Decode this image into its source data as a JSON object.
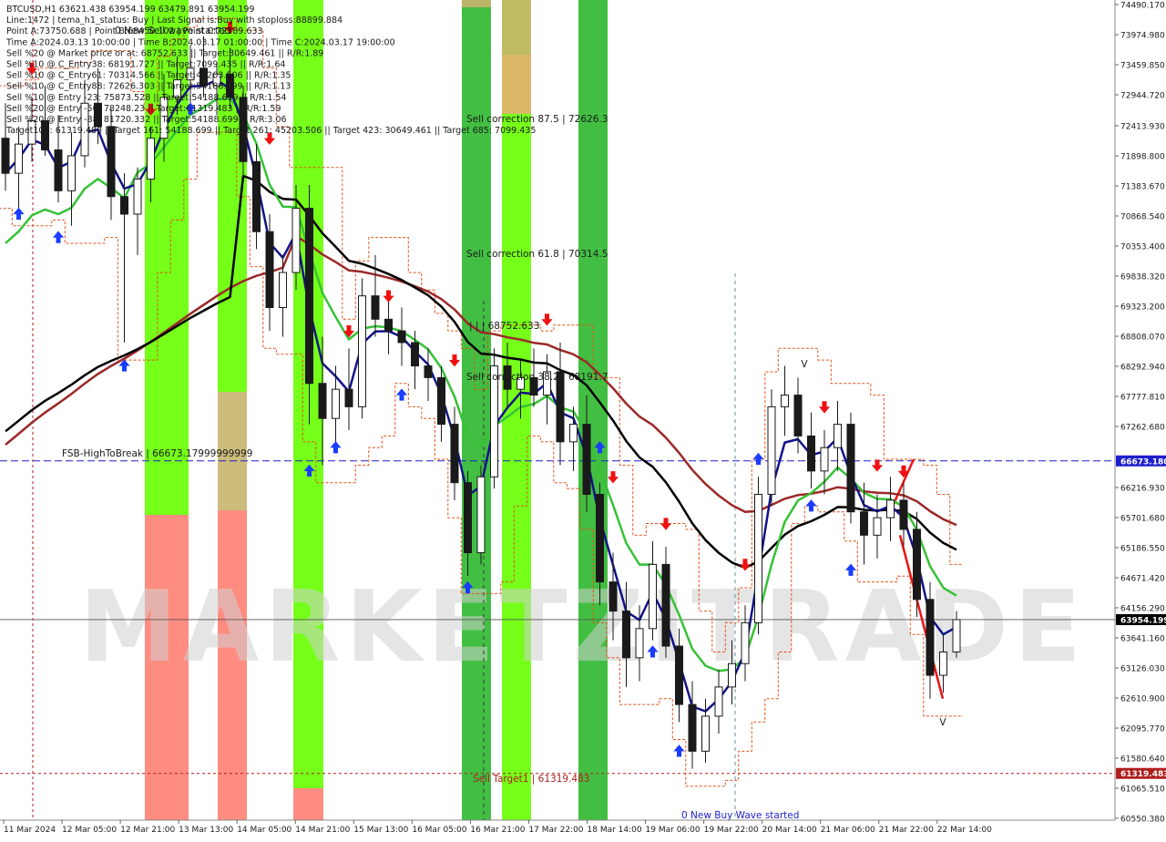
{
  "chart_data": {
    "type": "candlestick",
    "symbol": "BTCUSD",
    "timeframe": "H1",
    "info_lines": [
      "BTCUSD,H1   63621.438 63954.199 63479.891 63954.199",
      "Line:1472 | tema_h1_status: Buy | Last Signal is:Buy with stoploss:88899.884",
      "Point A:73750.688 | Point B:68450.102 | Point C:72389.633",
      "Time A:2024.03.13 10:00:00 | Time B:2024.03.17 01:00:00 | Time C:2024.03.17 19:00:00",
      "Sell %20 @ Market price or at: 68752.633 || Target:30649.461 || R/R:1.89",
      "Sell %10 @ C_Entry38: 68191.727 || Target:7099.435 || R/R:1.64",
      "Sell %10 @ C_Entry61: 70314.566 || Target:45203.506 || R/R:1.35",
      "Sell %10 @ C_Entry88: 72626.303 || Target:54188.699 || R/R:1.13",
      "Sell %10 @ Entry -23: 75873.528 || Target:54188.699 || R/R:1.54",
      "Sell %20 @ Entry -50: 78248.23 || Target:61319.483 || R/R:1.59",
      "Sell %20 @ Entry -88: 81720.332 || Target:54188.699 || R/R:3.06",
      "Target100: 61319.483 || Target 161: 54188.699 || Target 261: 45203.506 || Target 423: 30649.461 || Target 685: 7099.435"
    ],
    "y_ticks": [
      "74490.170",
      "73974.980",
      "73459.850",
      "72944.720",
      "72413.930",
      "71898.800",
      "71383.670",
      "70868.540",
      "70353.400",
      "69838.320",
      "69323.200",
      "68808.070",
      "68292.940",
      "67777.810",
      "67262.680",
      "66216.930",
      "65701.680",
      "65186.550",
      "64671.420",
      "64156.290",
      "63641.160",
      "63126.030",
      "62610.900",
      "62095.770",
      "61580.640",
      "61065.510",
      "60550.380"
    ],
    "x_ticks": [
      "11 Mar 2024",
      "12 Mar 05:00",
      "12 Mar 21:00",
      "13 Mar 13:00",
      "14 Mar 05:00",
      "14 Mar 21:00",
      "15 Mar 13:00",
      "16 Mar 05:00",
      "16 Mar 21:00",
      "17 Mar 22:00",
      "18 Mar 14:00",
      "19 Mar 06:00",
      "19 Mar 22:00",
      "20 Mar 14:00",
      "21 Mar 06:00",
      "21 Mar 22:00",
      "22 Mar 14:00"
    ],
    "price_markers": [
      {
        "label": "66673.180",
        "color": "#1e1ecc"
      },
      {
        "label": "63954.199",
        "color": "#000000"
      },
      {
        "label": "61319.483",
        "color": "#b01e1e"
      }
    ],
    "annotations": {
      "sell_wave": "0 New Sell wave started",
      "buy_wave": "0 New Buy Wave started",
      "fsb": "FSB-HighToBreak | 66673.17999999999",
      "sell_corr_875": "Sell correction 87.5 | 72626.3",
      "sell_corr_618": "Sell correction 61.8 | 70314.5",
      "sell_corr_382": "Sell correction 38.2 | 68191.7",
      "level_iii": "| | | 68752.633",
      "sell_target": "Sell Target1 | 61319.483",
      "wave_v_top": "V",
      "wave_v_bottom": "V"
    },
    "watermark": "MARKETZITRADE",
    "colors": {
      "bull": "#1a1a1a",
      "bear": "#1a1a1a",
      "ma_blue": "#121288",
      "ma_green": "#36c136",
      "ma_black": "#000000",
      "ma_brown": "#9b2828",
      "bright_green": "#66ff00",
      "dark_green": "#2eb82e",
      "salmon": "#ff7f73",
      "tan": "#c8b46e",
      "orange": "#e5b070"
    },
    "ohlc": [
      {
        "o": 72200,
        "h": 72800,
        "l": 71300,
        "c": 71600
      },
      {
        "o": 71600,
        "h": 72400,
        "l": 71000,
        "c": 72100
      },
      {
        "o": 72100,
        "h": 72900,
        "l": 71800,
        "c": 72500
      },
      {
        "o": 72500,
        "h": 73100,
        "l": 71900,
        "c": 72000
      },
      {
        "o": 72000,
        "h": 72600,
        "l": 71100,
        "c": 71300
      },
      {
        "o": 71300,
        "h": 72300,
        "l": 70700,
        "c": 71900
      },
      {
        "o": 71900,
        "h": 73200,
        "l": 71700,
        "c": 72800
      },
      {
        "o": 72800,
        "h": 73400,
        "l": 72100,
        "c": 72400
      },
      {
        "o": 72400,
        "h": 72700,
        "l": 70800,
        "c": 71200
      },
      {
        "o": 71200,
        "h": 71600,
        "l": 68700,
        "c": 70900
      },
      {
        "o": 70900,
        "h": 71700,
        "l": 70200,
        "c": 71500
      },
      {
        "o": 71500,
        "h": 72400,
        "l": 71100,
        "c": 72200
      },
      {
        "o": 72200,
        "h": 73300,
        "l": 71800,
        "c": 72900
      },
      {
        "o": 72900,
        "h": 73600,
        "l": 72600,
        "c": 73200
      },
      {
        "o": 73200,
        "h": 73800,
        "l": 72800,
        "c": 73400
      },
      {
        "o": 73400,
        "h": 73950,
        "l": 72900,
        "c": 73100
      },
      {
        "o": 73100,
        "h": 73500,
        "l": 72600,
        "c": 73300
      },
      {
        "o": 73300,
        "h": 73750,
        "l": 72700,
        "c": 72900
      },
      {
        "o": 72900,
        "h": 73100,
        "l": 71500,
        "c": 71800
      },
      {
        "o": 71800,
        "h": 72100,
        "l": 70300,
        "c": 70600
      },
      {
        "o": 70600,
        "h": 70900,
        "l": 68900,
        "c": 69300
      },
      {
        "o": 69300,
        "h": 70200,
        "l": 68800,
        "c": 69900
      },
      {
        "o": 69900,
        "h": 71400,
        "l": 69600,
        "c": 71000
      },
      {
        "o": 71000,
        "h": 71400,
        "l": 67300,
        "c": 68000
      },
      {
        "o": 68000,
        "h": 68800,
        "l": 66600,
        "c": 67400
      },
      {
        "o": 67400,
        "h": 68300,
        "l": 66900,
        "c": 67900
      },
      {
        "o": 67900,
        "h": 68600,
        "l": 67200,
        "c": 67600
      },
      {
        "o": 67600,
        "h": 69800,
        "l": 67400,
        "c": 69500
      },
      {
        "o": 69500,
        "h": 70200,
        "l": 68800,
        "c": 69100
      },
      {
        "o": 69100,
        "h": 69600,
        "l": 68500,
        "c": 68900
      },
      {
        "o": 68900,
        "h": 69300,
        "l": 68300,
        "c": 68700
      },
      {
        "o": 68700,
        "h": 68900,
        "l": 67900,
        "c": 68300
      },
      {
        "o": 68300,
        "h": 68600,
        "l": 67700,
        "c": 68100
      },
      {
        "o": 68100,
        "h": 68300,
        "l": 67000,
        "c": 67300
      },
      {
        "o": 67300,
        "h": 67600,
        "l": 66000,
        "c": 66300
      },
      {
        "o": 66300,
        "h": 66500,
        "l": 64700,
        "c": 65100
      },
      {
        "o": 65100,
        "h": 66600,
        "l": 64900,
        "c": 66400
      },
      {
        "o": 66400,
        "h": 68600,
        "l": 66200,
        "c": 68300
      },
      {
        "o": 68300,
        "h": 68700,
        "l": 67600,
        "c": 67900
      },
      {
        "o": 67900,
        "h": 68400,
        "l": 67400,
        "c": 68100
      },
      {
        "o": 68100,
        "h": 68600,
        "l": 67600,
        "c": 67800
      },
      {
        "o": 67800,
        "h": 68500,
        "l": 67300,
        "c": 68200
      },
      {
        "o": 68200,
        "h": 68700,
        "l": 66600,
        "c": 67000
      },
      {
        "o": 67000,
        "h": 67600,
        "l": 66500,
        "c": 67300
      },
      {
        "o": 67300,
        "h": 67800,
        "l": 65800,
        "c": 66100
      },
      {
        "o": 66100,
        "h": 66300,
        "l": 64200,
        "c": 64600
      },
      {
        "o": 64600,
        "h": 65100,
        "l": 63600,
        "c": 64100
      },
      {
        "o": 64100,
        "h": 64600,
        "l": 62800,
        "c": 63300
      },
      {
        "o": 63300,
        "h": 64200,
        "l": 62900,
        "c": 63800
      },
      {
        "o": 63800,
        "h": 65300,
        "l": 63600,
        "c": 64900
      },
      {
        "o": 64900,
        "h": 65200,
        "l": 63300,
        "c": 63500
      },
      {
        "o": 63500,
        "h": 63800,
        "l": 62200,
        "c": 62500
      },
      {
        "o": 62500,
        "h": 62900,
        "l": 61400,
        "c": 61700
      },
      {
        "o": 61700,
        "h": 62600,
        "l": 61500,
        "c": 62300
      },
      {
        "o": 62300,
        "h": 63100,
        "l": 62000,
        "c": 62800
      },
      {
        "o": 62800,
        "h": 63600,
        "l": 62500,
        "c": 63200
      },
      {
        "o": 63200,
        "h": 64200,
        "l": 62900,
        "c": 63900
      },
      {
        "o": 63900,
        "h": 66400,
        "l": 63700,
        "c": 66100
      },
      {
        "o": 66100,
        "h": 67900,
        "l": 65900,
        "c": 67600
      },
      {
        "o": 67600,
        "h": 68300,
        "l": 67100,
        "c": 67800
      },
      {
        "o": 67800,
        "h": 68100,
        "l": 66800,
        "c": 67100
      },
      {
        "o": 67100,
        "h": 67500,
        "l": 66200,
        "c": 66500
      },
      {
        "o": 66500,
        "h": 67200,
        "l": 66100,
        "c": 66900
      },
      {
        "o": 66900,
        "h": 67700,
        "l": 66500,
        "c": 67300
      },
      {
        "o": 67300,
        "h": 67500,
        "l": 65600,
        "c": 65800
      },
      {
        "o": 65800,
        "h": 66300,
        "l": 64900,
        "c": 65400
      },
      {
        "o": 65400,
        "h": 66100,
        "l": 65000,
        "c": 65700
      },
      {
        "o": 65700,
        "h": 66400,
        "l": 65300,
        "c": 66000
      },
      {
        "o": 66000,
        "h": 66300,
        "l": 65200,
        "c": 65500
      },
      {
        "o": 65500,
        "h": 65800,
        "l": 64000,
        "c": 64300
      },
      {
        "o": 64300,
        "h": 64600,
        "l": 62600,
        "c": 63000
      },
      {
        "o": 63000,
        "h": 63700,
        "l": 62700,
        "c": 63400
      },
      {
        "o": 63400,
        "h": 64100,
        "l": 63300,
        "c": 63954.199
      }
    ]
  }
}
